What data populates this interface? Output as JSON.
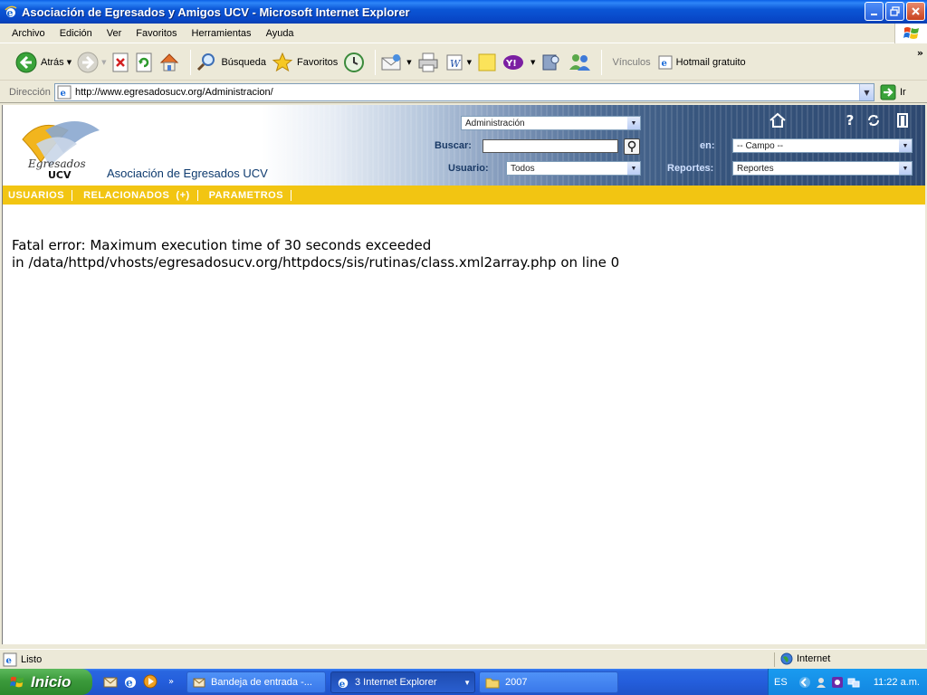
{
  "window": {
    "title": "Asociación de Egresados y Amigos UCV - Microsoft Internet Explorer"
  },
  "menu": [
    "Archivo",
    "Edición",
    "Ver",
    "Favoritos",
    "Herramientas",
    "Ayuda"
  ],
  "toolbar": {
    "back_label": "Atrás",
    "search_label": "Búsqueda",
    "favorites_label": "Favoritos",
    "links_label": "Vínculos",
    "hotmail_label": "Hotmail gratuito",
    "more": "»"
  },
  "address": {
    "label": "Dirección",
    "url": "http://www.egresadosucv.org/Administracion/",
    "go_label": "Ir"
  },
  "site": {
    "logo_text": "Egresados",
    "logo_sub": "UCV",
    "name": "Asociación de Egresados UCV",
    "section_select": "Administración",
    "search_label": "Buscar:",
    "user_label": "Usuario:",
    "user_select": "Todos",
    "in_label": "en:",
    "field_select": "-- Campo --",
    "reports_label": "Reportes:",
    "reports_select": "Reportes",
    "help_glyph": "?",
    "nav": [
      "USUARIOS",
      "RELACIONADOS  (+)",
      "PARAMETROS"
    ]
  },
  "error": {
    "label": "Fatal error",
    "message": ": Maximum execution time of 30 seconds exceeded",
    "in_word": "in",
    "path": "/data/httpd/vhosts/egresadosucv.org/httpdocs/sis/rutinas/class.xml2array.php",
    "on_line": "on line",
    "line": "0"
  },
  "status": {
    "text": "Listo",
    "zone": "Internet"
  },
  "taskbar": {
    "start_label": "Inicio",
    "more": "»",
    "tasks": [
      "Bandeja de entrada -...",
      "3 Internet Explorer",
      "2007"
    ],
    "lang": "ES",
    "clock": "11:22 a.m."
  },
  "colors": {
    "nav_bar": "#F2C512",
    "header_dark": "#2D4870",
    "xp_blue": "#245EDC"
  }
}
